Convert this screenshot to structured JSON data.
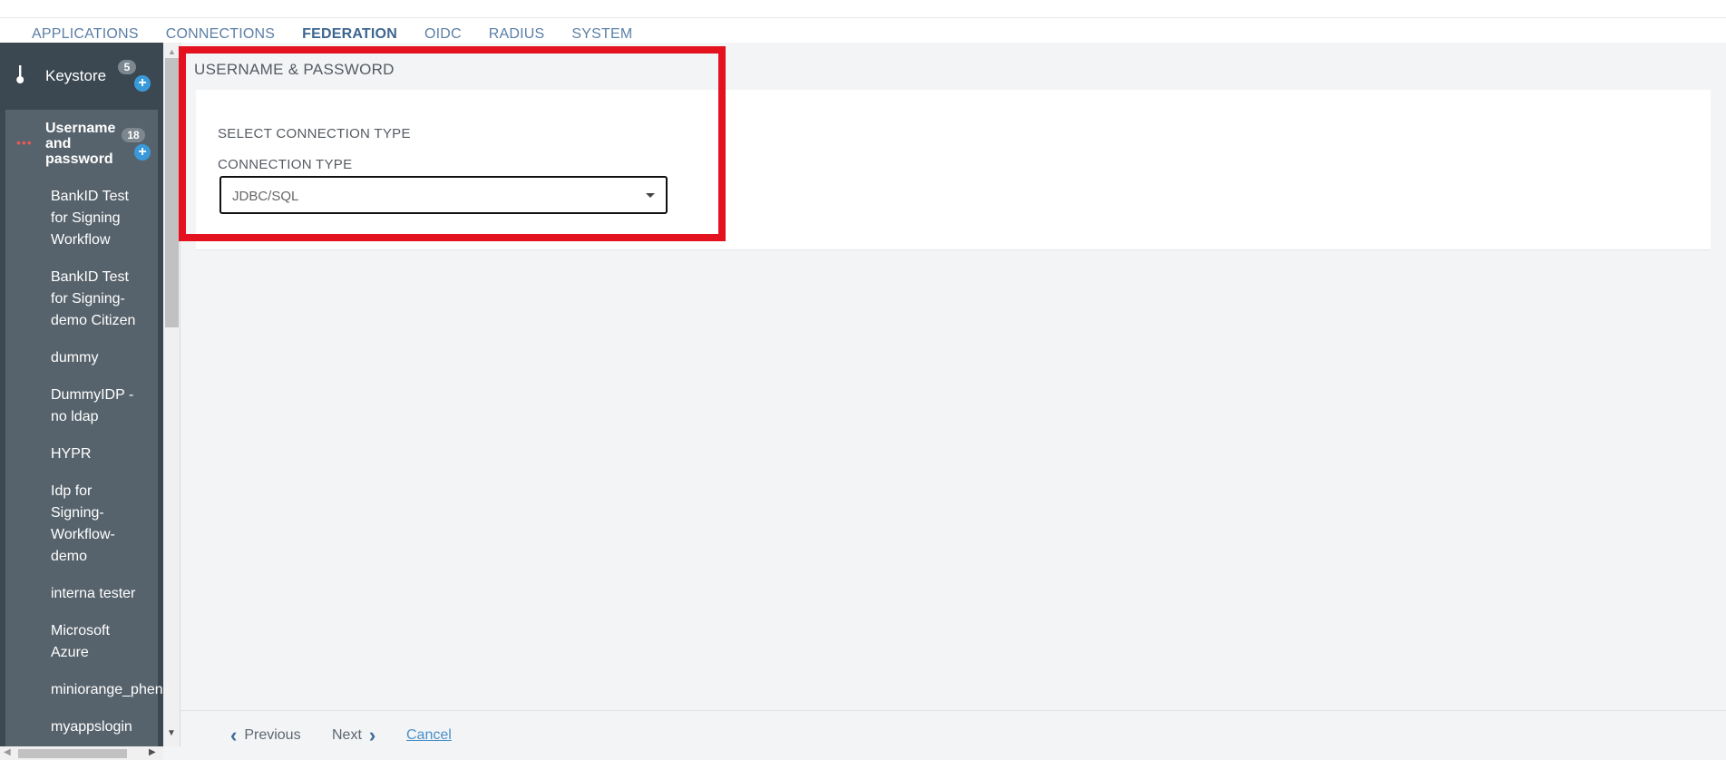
{
  "topnav": {
    "tabs": [
      {
        "label": "APPLICATIONS"
      },
      {
        "label": "CONNECTIONS"
      },
      {
        "label": "FEDERATION"
      },
      {
        "label": "OIDC"
      },
      {
        "label": "RADIUS"
      },
      {
        "label": "SYSTEM"
      }
    ],
    "active_tab": "FEDERATION"
  },
  "sidebar": {
    "keystore": {
      "label": "Keystore",
      "count": "5"
    },
    "group": {
      "label": "Username and password",
      "count": "18",
      "items": [
        {
          "label": "BankID Test for Signing Workflow"
        },
        {
          "label": "BankID Test for Signing-demo Citizen"
        },
        {
          "label": "dummy"
        },
        {
          "label": "DummyIDP - no ldap"
        },
        {
          "label": "HYPR"
        },
        {
          "label": "Idp for Signing-Workflow-demo"
        },
        {
          "label": "interna tester"
        },
        {
          "label": "Microsoft Azure"
        },
        {
          "label": "miniorange_phen"
        },
        {
          "label": "myappslogin"
        }
      ]
    }
  },
  "main": {
    "section_title": "USERNAME & PASSWORD",
    "sub_heading": "SELECT CONNECTION TYPE",
    "connection_type": {
      "label": "CONNECTION TYPE",
      "value": "JDBC/SQL"
    }
  },
  "footer": {
    "previous_label": "Previous",
    "next_label": "Next",
    "cancel_label": "Cancel"
  },
  "colors": {
    "sidebar_bg": "#3b4852",
    "group_bg": "#57636c",
    "accent": "#3a9ad9",
    "highlight": "#e3121e",
    "nav_text": "#5b7fa6"
  }
}
